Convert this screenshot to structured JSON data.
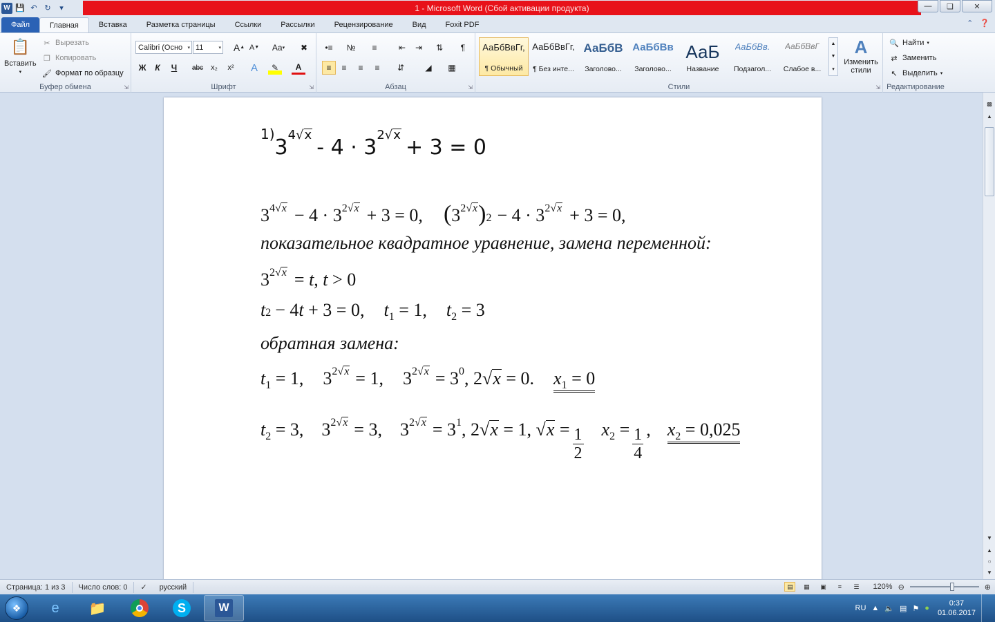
{
  "window": {
    "title": "1  -  Microsoft Word (Сбой активации продукта)",
    "controls": [
      "minimize-icon",
      "restore-icon",
      "close-icon"
    ]
  },
  "qat": [
    "word-logo-icon",
    "save-icon",
    "undo-icon",
    "redo-icon",
    "customize-icon"
  ],
  "tabs": {
    "file": "Файл",
    "home": "Главная",
    "insert": "Вставка",
    "layout": "Разметка страницы",
    "references": "Ссылки",
    "mailings": "Рассылки",
    "review": "Рецензирование",
    "view": "Вид",
    "foxit": "Foxit PDF"
  },
  "ribbon": {
    "clipboard": {
      "label": "Буфер обмена",
      "paste": "Вставить",
      "cut": "Вырезать",
      "copy": "Копировать",
      "format_painter": "Формат по образцу"
    },
    "font": {
      "label": "Шрифт",
      "family": "Calibri (Осно",
      "size": "11",
      "bold": "Ж",
      "italic": "К",
      "underline": "Ч",
      "strike": "abc",
      "subscript": "x₂",
      "superscript": "x²",
      "grow": "A",
      "shrink": "A",
      "case": "Aa"
    },
    "paragraph": {
      "label": "Абзац"
    },
    "styles": {
      "label": "Стили",
      "items": [
        {
          "preview": "АаБбВвГг,",
          "name": "¶ Обычный"
        },
        {
          "preview": "АаБбВвГг,",
          "name": "¶ Без инте..."
        },
        {
          "preview": "АаБбВ",
          "name": "Заголово..."
        },
        {
          "preview": "АаБбВв",
          "name": "Заголово..."
        },
        {
          "preview": "АаБ",
          "name": "Название"
        },
        {
          "preview": "АаБбВв.",
          "name": "Подзагол..."
        },
        {
          "preview": "АаБбВвГ",
          "name": "Слабое в..."
        }
      ],
      "change_styles": "Изменить стили"
    },
    "editing": {
      "label": "Редактирование",
      "find": "Найти",
      "replace": "Заменить",
      "select": "Выделить"
    }
  },
  "document": {
    "text_line1": "показательное квадратное уравнение, замена переменной:",
    "text_line2": "обратная замена:"
  },
  "statusbar": {
    "page": "Страница: 1 из 3",
    "words": "Число слов: 0",
    "language": "русский",
    "zoom": "120%"
  },
  "taskbar": {
    "lang": "RU",
    "time": "0:37",
    "date": "01.06.2017"
  }
}
